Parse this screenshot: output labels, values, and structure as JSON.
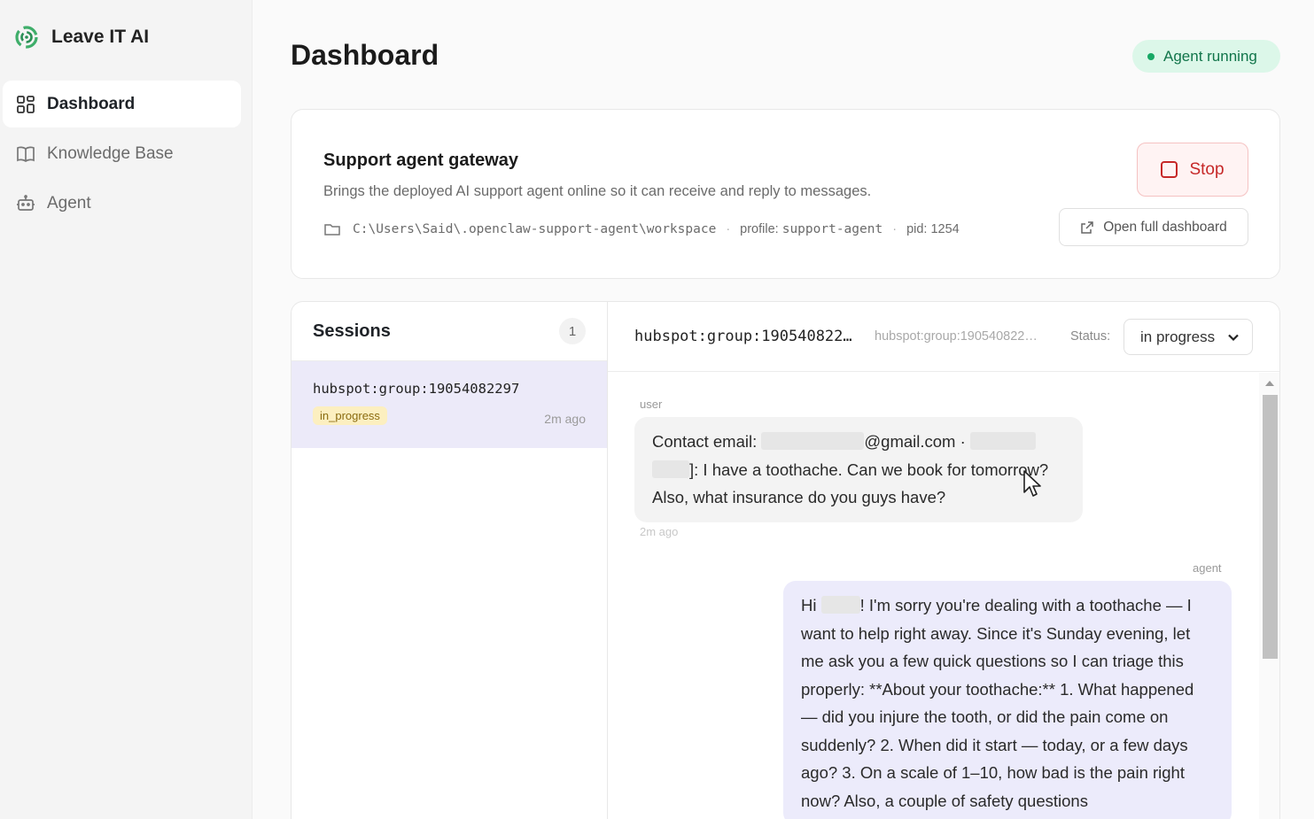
{
  "app": {
    "name": "Leave IT AI",
    "logo_icon": "brand-swirl-icon"
  },
  "sidebar": {
    "items": [
      {
        "label": "Dashboard",
        "icon": "grid-icon",
        "active": true
      },
      {
        "label": "Knowledge Base",
        "icon": "book-icon",
        "active": false
      },
      {
        "label": "Agent",
        "icon": "bot-icon",
        "active": false
      }
    ]
  },
  "header": {
    "title": "Dashboard",
    "status": "Agent running",
    "status_color": "#17a865"
  },
  "gateway": {
    "title": "Support agent gateway",
    "description": "Brings the deployed AI support agent online so it can receive and reply to messages.",
    "path": "C:\\Users\\Said\\.openclaw-support-agent\\workspace",
    "profile_label": "profile:",
    "profile": "support-agent",
    "pid_label": "pid:",
    "pid": "1254",
    "stop_label": "Stop",
    "open_label": "Open full dashboard"
  },
  "sessions": {
    "title": "Sessions",
    "count": "1",
    "items": [
      {
        "name": "hubspot:group:19054082297",
        "status": "in_progress",
        "time": "2m ago"
      }
    ]
  },
  "chat": {
    "id": "hubspot:group:190540822…",
    "subtitle": "hubspot:group:190540822…",
    "status_label": "Status:",
    "status_value": "in progress",
    "messages": [
      {
        "role": "user",
        "text_part1": "Contact email:",
        "text_part2": "@gmail.com ·",
        "text_part3": "]: I have a toothache. Can we book for tomorrow? Also, what insurance do you guys have?",
        "time": "2m ago"
      },
      {
        "role": "agent",
        "text_part1": "Hi",
        "text_part2": "! I'm sorry you're dealing with a toothache — I want to help right away. Since it's Sunday evening, let me ask you a few quick questions so I can triage this properly: **About your toothache:** 1. What happened — did you injure the tooth, or did the pain come on suddenly? 2. When did it start — today, or a few days ago? 3. On a scale of 1–10, how bad is the pain right now? Also, a couple of safety questions"
      }
    ]
  }
}
